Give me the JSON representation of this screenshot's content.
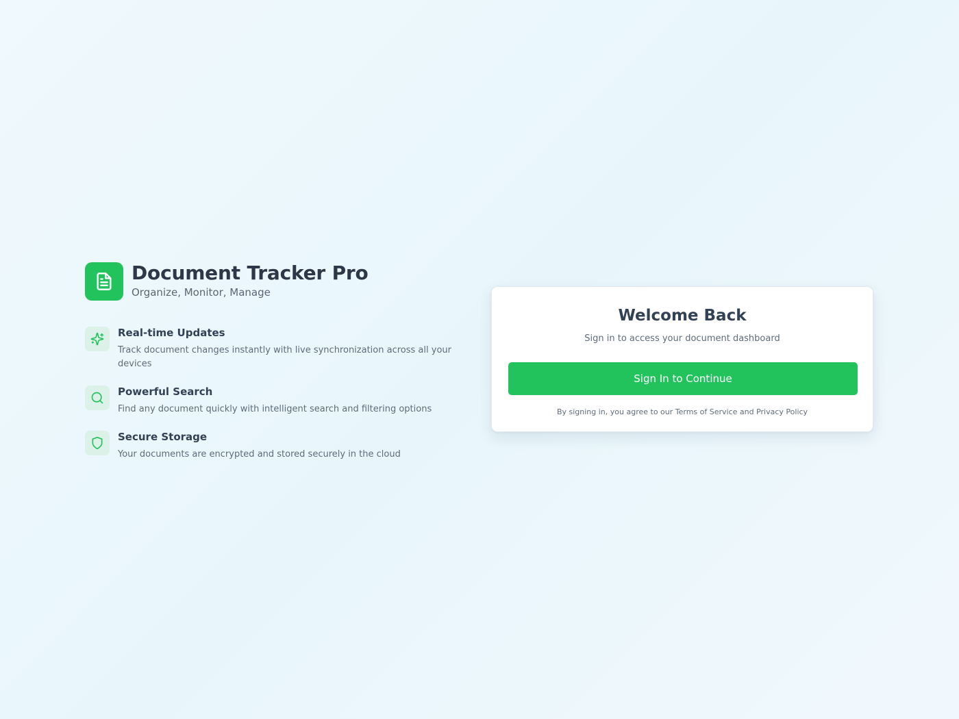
{
  "brand": {
    "title": "Document Tracker Pro",
    "tagline": "Organize, Monitor, Manage",
    "logo_icon": "document-icon",
    "accent_color": "#22c35d"
  },
  "features": [
    {
      "icon": "sparkles-icon",
      "title": "Real-time Updates",
      "description": "Track document changes instantly with live synchronization across all your devices"
    },
    {
      "icon": "search-icon",
      "title": "Powerful Search",
      "description": "Find any document quickly with intelligent search and filtering options"
    },
    {
      "icon": "shield-icon",
      "title": "Secure Storage",
      "description": "Your documents are encrypted and stored securely in the cloud"
    }
  ],
  "login": {
    "title": "Welcome Back",
    "subtitle": "Sign in to access your document dashboard",
    "button_label": "Sign In to Continue",
    "terms": "By signing in, you agree to our Terms of Service and Privacy Policy"
  }
}
